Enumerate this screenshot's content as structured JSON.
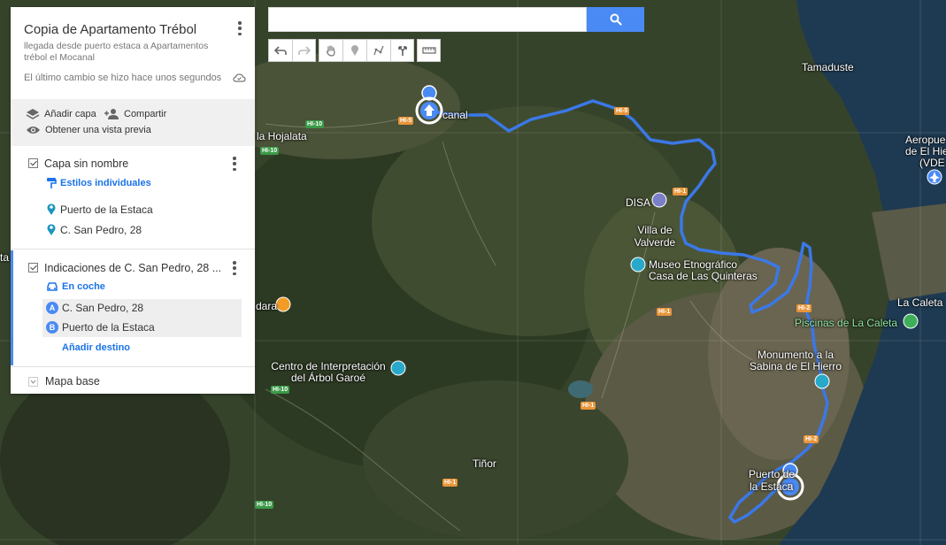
{
  "panel": {
    "title": "Copia de Apartamento Trébol",
    "description": "llegada desde puerto estaca a Apartamentos trébol el Mocanal",
    "last_change": "El último cambio se hizo hace unos segundos",
    "add_layer": "Añadir capa",
    "share": "Compartir",
    "preview": "Obtener una vista previa",
    "layer1": {
      "title": "Capa sin nombre",
      "style": "Estilos individuales",
      "items": [
        "Puerto de la Estaca",
        "C. San Pedro, 28"
      ]
    },
    "layer2": {
      "title": "Indicaciones de C. San Pedro, 28 ...",
      "mode": "En coche",
      "stops": [
        {
          "letter": "A",
          "label": "C. San Pedro, 28"
        },
        {
          "letter": "B",
          "label": "Puerto de la Estaca"
        }
      ],
      "add_destination": "Añadir destino"
    },
    "base_map": "Mapa base"
  },
  "search": {
    "value": "",
    "placeholder": ""
  },
  "toolbar": {
    "icons": [
      "undo-icon",
      "redo-icon",
      "hand-icon",
      "marker-icon",
      "draw-line-icon",
      "directions-icon",
      "ruler-icon"
    ]
  },
  "map": {
    "labels": {
      "tamaduste": "Tamaduste",
      "aeropuerto": "Aeropue",
      "aeropuerto2": "de El Hie",
      "aeropuerto3": "(VDE",
      "la_hojalata": "la Hojalata",
      "mocanal": "canal",
      "disa": "DISA",
      "valverde1": "Villa de",
      "valverde2": "Valverde",
      "museo1": "Museo Etnográfico",
      "museo2": "Casa de Las Quinteras",
      "la_caleta": "La Caleta",
      "piscinas": "Piscinas de La Caleta",
      "monumento1": "Monumento a la",
      "monumento2": "Sabina de El Hierro",
      "centro1": "Centro de Interpretación",
      "centro2": "del Árbol Garoé",
      "dara": "dara",
      "tinor": "Tiñor",
      "puerto1": "Puerto de",
      "puerto2": "la Estaca",
      "left_edge": "ta"
    },
    "shields": {
      "hi10_a": "HI-10",
      "hi10_b": "HI-10",
      "hi10_c": "HI-10",
      "hi10_d": "HI-10",
      "hi5": "HI-5",
      "hi5b": "HI-5",
      "hi1_a": "HI-1",
      "hi1_b": "HI-1",
      "hi1_c": "HI-1",
      "hi1_d": "HI-1",
      "hi2_a": "HI-2",
      "hi2_b": "HI-2"
    },
    "colors": {
      "route": "#3b78e7",
      "marker": "#4a8af4",
      "accent": "#4a8af4"
    }
  }
}
